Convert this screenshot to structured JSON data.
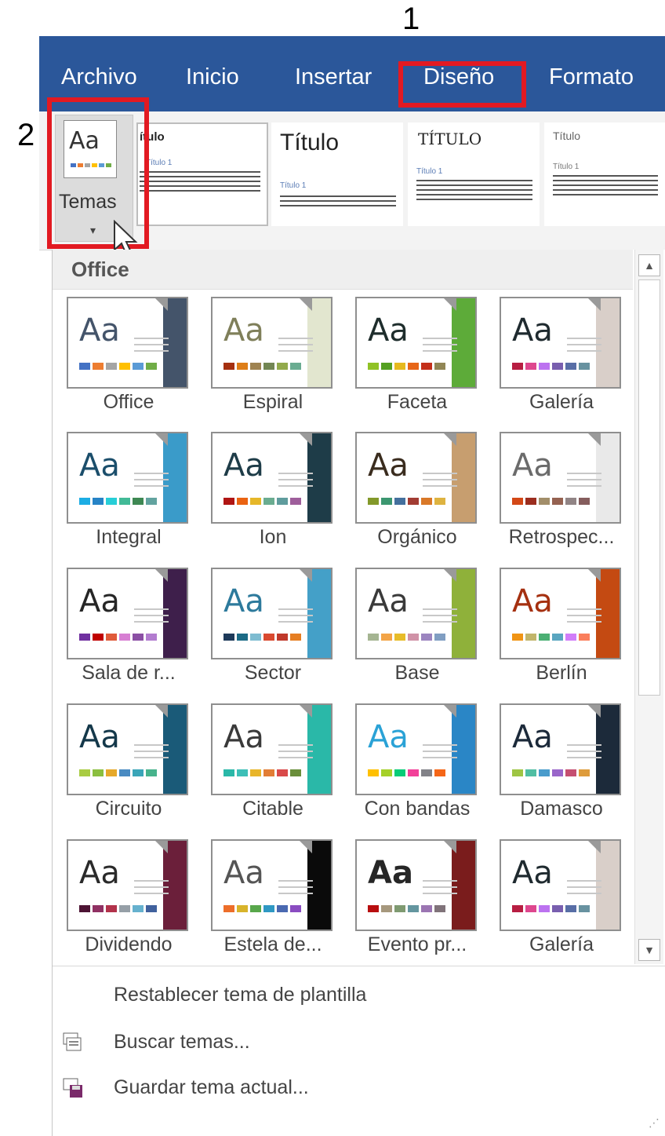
{
  "annotations": {
    "step1": "1",
    "step2": "2"
  },
  "tabs": [
    "Archivo",
    "Inicio",
    "Insertar",
    "Diseño",
    "Formato"
  ],
  "colors": {
    "ribbon_blue": "#2b579a",
    "highlight_red": "#e21a22"
  },
  "temas_button": {
    "label": "Temas",
    "icon": "themes-icon",
    "caret": "▾"
  },
  "style_gallery": [
    {
      "title": "ítulo",
      "sub": "Título 1"
    },
    {
      "title": "Título",
      "sub": "Título 1"
    },
    {
      "title": "TÍTULO",
      "sub": "Título 1"
    },
    {
      "title": "Título",
      "sub": "Título 1"
    }
  ],
  "dropdown": {
    "section_title": "Office",
    "themes": [
      {
        "name": "Office",
        "aa": "Aa",
        "aa_color": "#44546a",
        "accent": "#44546a",
        "swatches": [
          "#4472c4",
          "#ed7d31",
          "#a5a5a5",
          "#ffc000",
          "#5b9bd5",
          "#70ad47"
        ]
      },
      {
        "name": "Espiral",
        "aa": "Aa",
        "aa_color": "#7f7f5a",
        "accent": "#e2e6cf",
        "swatches": [
          "#a53010",
          "#de7e18",
          "#9f8351",
          "#728653",
          "#92aa4c",
          "#6aac91"
        ]
      },
      {
        "name": "Faceta",
        "aa": "Aa",
        "aa_color": "#1e2d2c",
        "accent": "#5dab39",
        "swatches": [
          "#90c226",
          "#54a021",
          "#e6b91e",
          "#e76618",
          "#c42f1a",
          "#918655"
        ]
      },
      {
        "name": "Galería",
        "aa": "Aa",
        "aa_color": "#1f2a2f",
        "accent": "#d9cfc9",
        "swatches": [
          "#b71e42",
          "#de478e",
          "#bc72f0",
          "#795faf",
          "#586ea6",
          "#6892a0"
        ]
      },
      {
        "name": "Integral",
        "aa": "Aa",
        "aa_color": "#1b4e6b",
        "accent": "#3a9bc9",
        "swatches": [
          "#1cade4",
          "#2683c6",
          "#27ced7",
          "#42ba97",
          "#3e8853",
          "#62a39f"
        ]
      },
      {
        "name": "Ion",
        "aa": "Aa",
        "aa_color": "#1e3c48",
        "accent": "#1e3c48",
        "swatches": [
          "#b01513",
          "#ea6312",
          "#e6b729",
          "#6aac90",
          "#5f9c9d",
          "#9e5e9b"
        ]
      },
      {
        "name": "Orgánico",
        "aa": "Aa",
        "aa_color": "#3a2c1e",
        "accent": "#c79e6f",
        "swatches": [
          "#83992a",
          "#3c9770",
          "#44709d",
          "#a23c33",
          "#d97828",
          "#deb340"
        ]
      },
      {
        "name": "Retrospec...",
        "aa": "Aa",
        "aa_color": "#6b6b6b",
        "accent": "#e9e9e9",
        "swatches": [
          "#d34817",
          "#9b2d1f",
          "#a28e6a",
          "#956251",
          "#918485",
          "#855d5d"
        ]
      },
      {
        "name": "Sala de r...",
        "aa": "Aa",
        "aa_color": "#262626",
        "accent": "#3e1f4b",
        "swatches": [
          "#7030a0",
          "#c00000",
          "#e05b3a",
          "#d77fd3",
          "#8b4fa4",
          "#b27ccf"
        ]
      },
      {
        "name": "Sector",
        "aa": "Aa",
        "aa_color": "#2d7a9c",
        "accent": "#44a0c8",
        "swatches": [
          "#1e3a5a",
          "#1c6b86",
          "#7ebcd1",
          "#d94a30",
          "#c0392b",
          "#e67e22"
        ]
      },
      {
        "name": "Base",
        "aa": "Aa",
        "aa_color": "#3a3a3a",
        "accent": "#8fb13a",
        "swatches": [
          "#a5b592",
          "#f3a447",
          "#e7bc29",
          "#d092a7",
          "#9c85c0",
          "#809ec2"
        ]
      },
      {
        "name": "Berlín",
        "aa": "Aa",
        "aa_color": "#a53010",
        "accent": "#c44a12",
        "swatches": [
          "#f09415",
          "#c1b56b",
          "#4baf73",
          "#5aa6c0",
          "#d17df9",
          "#fa7e5c"
        ]
      },
      {
        "name": "Circuito",
        "aa": "Aa",
        "aa_color": "#14384a",
        "accent": "#1a5a78",
        "swatches": [
          "#a9cc43",
          "#8bbf3f",
          "#e6a92b",
          "#4a8bc2",
          "#3aa5b8",
          "#47b38c"
        ]
      },
      {
        "name": "Citable",
        "aa": "Aa",
        "aa_color": "#3a3a3a",
        "accent": "#2ab8a8",
        "swatches": [
          "#2ab8a8",
          "#3dbfb7",
          "#e8b52a",
          "#e27d35",
          "#d94a4a",
          "#6a8e3a"
        ]
      },
      {
        "name": "Con bandas",
        "aa": "Aa",
        "aa_color": "#2aa2d6",
        "accent": "#2a86c6",
        "swatches": [
          "#ffc000",
          "#a5d028",
          "#08cc78",
          "#f24099",
          "#828288",
          "#f56617"
        ]
      },
      {
        "name": "Damasco",
        "aa": "Aa",
        "aa_color": "#1c2a3a",
        "accent": "#1c2a3a",
        "swatches": [
          "#9ec544",
          "#50bea3",
          "#4a9ccc",
          "#9a66ca",
          "#c54f71",
          "#de9c3c"
        ]
      },
      {
        "name": "Dividendo",
        "aa": "Aa",
        "aa_color": "#2a2a2a",
        "accent": "#6b1f3a",
        "swatches": [
          "#4d1434",
          "#903163",
          "#b2324b",
          "#969fa7",
          "#66b1ce",
          "#40619d"
        ]
      },
      {
        "name": "Estela de...",
        "aa": "Aa",
        "aa_color": "#555555",
        "accent": "#0a0a0a",
        "swatches": [
          "#ed6e2a",
          "#d8b42b",
          "#58a74b",
          "#2f98c3",
          "#4a69b1",
          "#8a4cc1"
        ]
      },
      {
        "name": "Evento pr...",
        "aa": "Aa",
        "aa_color": "#262626",
        "accent": "#7a1c1c",
        "swatches": [
          "#b80e0f",
          "#a6987d",
          "#7f9a71",
          "#64969f",
          "#9b75b2",
          "#80737a"
        ]
      },
      {
        "name": "Galería",
        "aa": "Aa",
        "aa_color": "#1f2a2f",
        "accent": "#d9cfc9",
        "swatches": [
          "#b71e42",
          "#de478e",
          "#bc72f0",
          "#795faf",
          "#586ea6",
          "#6892a0"
        ]
      }
    ],
    "scroll_up": "▲",
    "scroll_down": "▼",
    "menu": {
      "reset": "Restablecer tema de plantilla",
      "search": "Buscar temas...",
      "save": "Guardar tema actual..."
    }
  }
}
